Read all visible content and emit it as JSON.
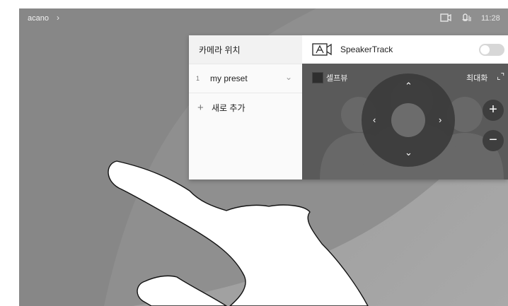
{
  "topbar": {
    "title": "acano",
    "chevron_icon": "chevron-right-icon",
    "camera_icon": "camera-icon",
    "mic_icon": "microphone-icon",
    "time": "11:28"
  },
  "panel": {
    "camera_position_title": "카메라 위치",
    "presets": [
      {
        "number": "1",
        "name": "my preset"
      }
    ],
    "add_new_label": "새로 추가",
    "speakertrack_label": "SpeakerTrack",
    "speakertrack_enabled": false,
    "selfview_label": "셀프뷰",
    "maximize_label": "최대화"
  },
  "colors": {
    "background_gray": "#9c9c9c",
    "panel_white": "#ffffff",
    "view_dark": "#5a5a5a",
    "control_ring": "#3b3b3b"
  }
}
